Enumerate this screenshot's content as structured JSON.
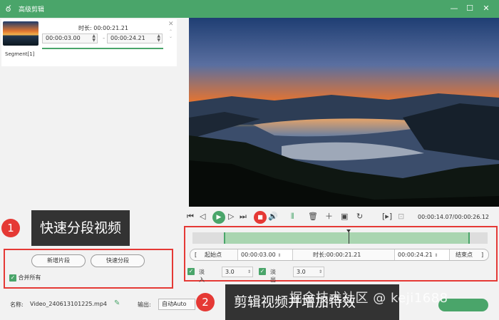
{
  "window": {
    "title": "高级剪辑",
    "logo": "双兔",
    "minimize_icon": "—",
    "maximize_icon": "☐",
    "close_icon": "✕"
  },
  "segment": {
    "duration_label": "时长:",
    "duration_value": "00:00:21.21",
    "start_time": "00:00:03.00",
    "end_time": "00:00:24.21",
    "separator": "-",
    "label": "Segment[1]"
  },
  "callouts": [
    {
      "number": "1",
      "text": "快速分段视频"
    },
    {
      "number": "2",
      "text": "剪辑视频并增加特效"
    }
  ],
  "left_actions": {
    "new_segment": "新增片段",
    "quick_split": "快速分段",
    "merge_all_label": "合并所有",
    "merge_all_checked": true
  },
  "playback": {
    "timecode": "00:00:14.07/00:00:26.12",
    "progress_fraction": 0.53
  },
  "timeline": {
    "selection_start_fraction": 0.106,
    "selection_end_fraction": 0.94,
    "playhead_fraction": 0.53
  },
  "range": {
    "start_bracket": "[",
    "start_label": "起始点",
    "start_value": "00:00:03.00",
    "duration_label": "时长:",
    "duration_value": "00:00:21.21",
    "end_value": "00:00:24.21",
    "end_label": "结束点",
    "end_bracket": "]"
  },
  "fade": {
    "fade_in_label": "淡入",
    "fade_in_value": "3.0",
    "fade_in_checked": true,
    "fade_out_label": "淡出",
    "fade_out_value": "3.0",
    "fade_out_checked": true
  },
  "bottom": {
    "name_label": "名称:",
    "file_name": "Video_240613101225.mp4",
    "output_label": "输出:",
    "output_value": "自动Auto"
  },
  "watermark": "掘金技术社区 @ keji1688",
  "colors": {
    "accent": "#4aa56a",
    "callout_red": "#e53935",
    "callout_bg": "#333333"
  }
}
